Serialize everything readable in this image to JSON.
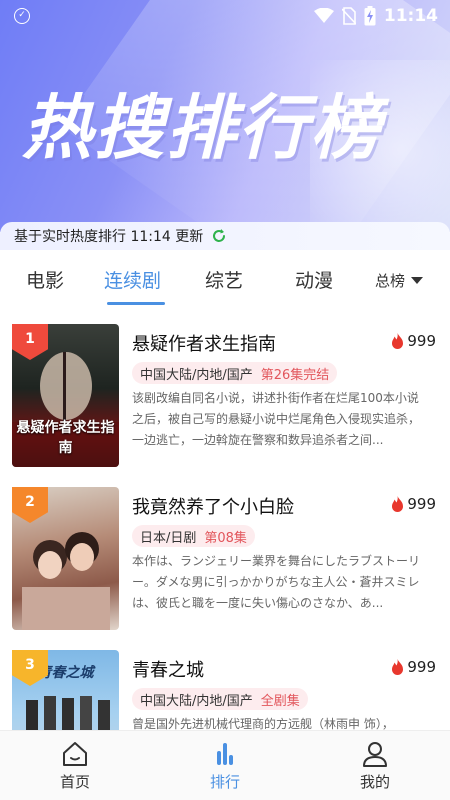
{
  "status": {
    "time": "11:14"
  },
  "hero": {
    "title": "热搜排行榜"
  },
  "update": {
    "text": "基于实时热度排行 11:14 更新"
  },
  "tabs": {
    "items": [
      {
        "label": "电影"
      },
      {
        "label": "连续剧"
      },
      {
        "label": "综艺"
      },
      {
        "label": "动漫"
      }
    ],
    "active_index": 1,
    "total_label": "总榜"
  },
  "list": [
    {
      "rank": "1",
      "title": "悬疑作者求生指南",
      "heat": "999",
      "region": "中国大陆/内地/国产",
      "status": "第26集完结",
      "desc": "该剧改编自同名小说，讲述扑街作者在烂尾100本小说之后，被自己写的悬疑小说中烂尾角色入侵现实追杀，一边逃亡，一边斡旋在警察和数异追杀者之间...",
      "poster_caption": "悬疑作者求生指南",
      "poster_style": "dark"
    },
    {
      "rank": "2",
      "title": "我竟然养了个小白脸",
      "heat": "999",
      "region": "日本/日剧",
      "status": "第08集",
      "desc": "本作は、ランジェリー業界を舞台にしたラブストーリー。ダメな男に引っかかりがちな主人公・蒼井スミレは、彼氏と職を一度に失い傷心のさなか、あ...",
      "poster_caption": "",
      "poster_style": "warm"
    },
    {
      "rank": "3",
      "title": "青春之城",
      "heat": "999",
      "region": "中国大陆/内地/国产",
      "status": "全剧集",
      "desc": "曾是国外先进机械代理商的方远舰（林雨申 饰），",
      "poster_caption": "青春之城",
      "poster_style": "light"
    }
  ],
  "nav": {
    "items": [
      {
        "label": "首页"
      },
      {
        "label": "排行"
      },
      {
        "label": "我的"
      }
    ],
    "active_index": 1
  },
  "colors": {
    "accent": "#4a90e2",
    "heat_flame": "#e8372d",
    "status_tag": "#e2565c",
    "rank_1": "#ef4a3c",
    "rank_2": "#f5872b",
    "rank_3": "#f7b52b"
  }
}
